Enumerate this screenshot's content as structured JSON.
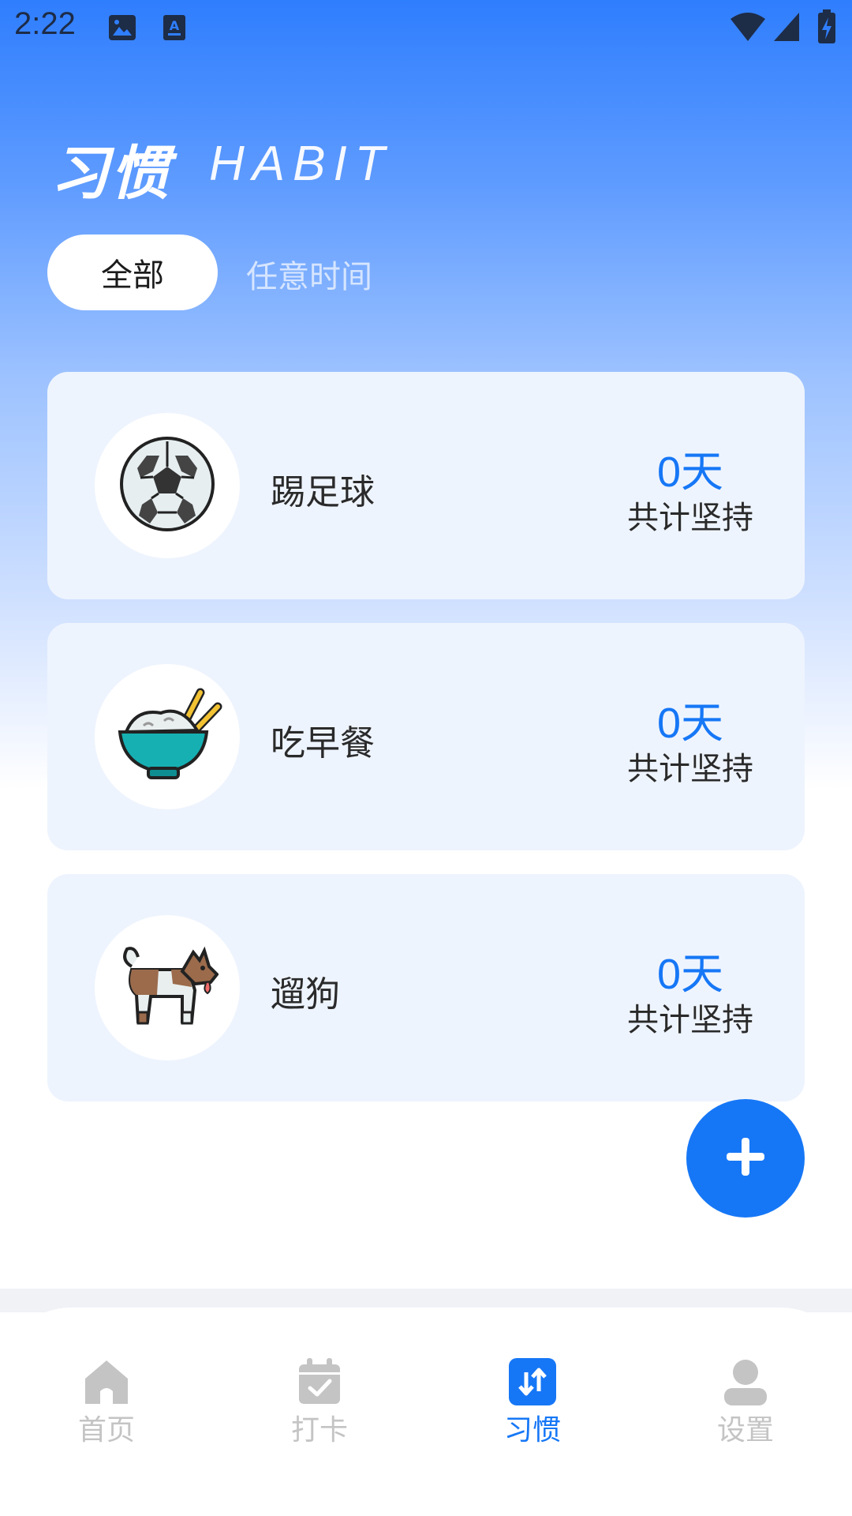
{
  "status_bar": {
    "time": "2:22"
  },
  "header": {
    "title": "习惯",
    "subtitle": "HABIT"
  },
  "filters": {
    "all": "全部",
    "anytime": "任意时间"
  },
  "habits": [
    {
      "name": "踢足球",
      "days": "0天",
      "caption": "共计坚持",
      "icon": "soccer-ball-icon"
    },
    {
      "name": "吃早餐",
      "days": "0天",
      "caption": "共计坚持",
      "icon": "rice-bowl-icon"
    },
    {
      "name": "遛狗",
      "days": "0天",
      "caption": "共计坚持",
      "icon": "dog-icon"
    }
  ],
  "bottom_nav": {
    "items": [
      {
        "label": "首页",
        "icon": "home-icon",
        "active": false
      },
      {
        "label": "打卡",
        "icon": "calendar-check-icon",
        "active": false
      },
      {
        "label": "习惯",
        "icon": "habit-swap-icon",
        "active": true
      },
      {
        "label": "设置",
        "icon": "user-icon",
        "active": false
      }
    ]
  },
  "colors": {
    "accent": "#1677f6",
    "card_background": "#eef4fe",
    "inactive_nav": "#c4c4c4"
  }
}
